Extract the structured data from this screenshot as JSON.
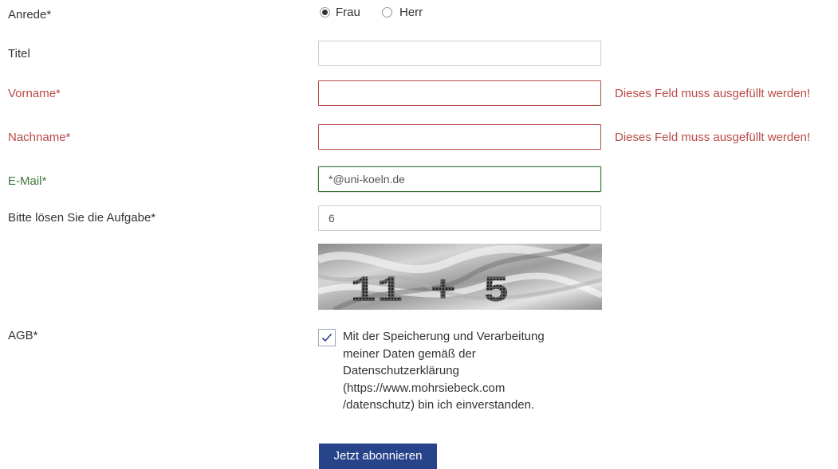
{
  "form": {
    "salutation": {
      "label": "Anrede*",
      "options": [
        {
          "label": "Frau",
          "checked": true
        },
        {
          "label": "Herr",
          "checked": false
        }
      ]
    },
    "title": {
      "label": "Titel",
      "value": ""
    },
    "firstname": {
      "label": "Vorname*",
      "value": "",
      "error": "Dieses Feld muss ausgefüllt werden!"
    },
    "lastname": {
      "label": "Nachname*",
      "value": "",
      "error": "Dieses Feld muss ausgefüllt werden!"
    },
    "email": {
      "label": "E-Mail*",
      "value": "*@uni-koeln.de"
    },
    "captcha": {
      "label": "Bitte lösen Sie die Aufgabe*",
      "value": "6",
      "image_text": "11 + 5"
    },
    "agb": {
      "label": "AGB*",
      "checked": true,
      "text_lines": [
        "Mit der Speicherung und Verarbeitung",
        "meiner Daten gemäß der",
        "Datenschutzerklärung",
        "(https://www.mohrsiebeck.com",
        "/datenschutz) bin ich einverstanden."
      ]
    },
    "submit_label": "Jetzt abonnieren"
  },
  "colors": {
    "error": "#b94a48",
    "success": "#3c763d",
    "button": "#27438a"
  }
}
